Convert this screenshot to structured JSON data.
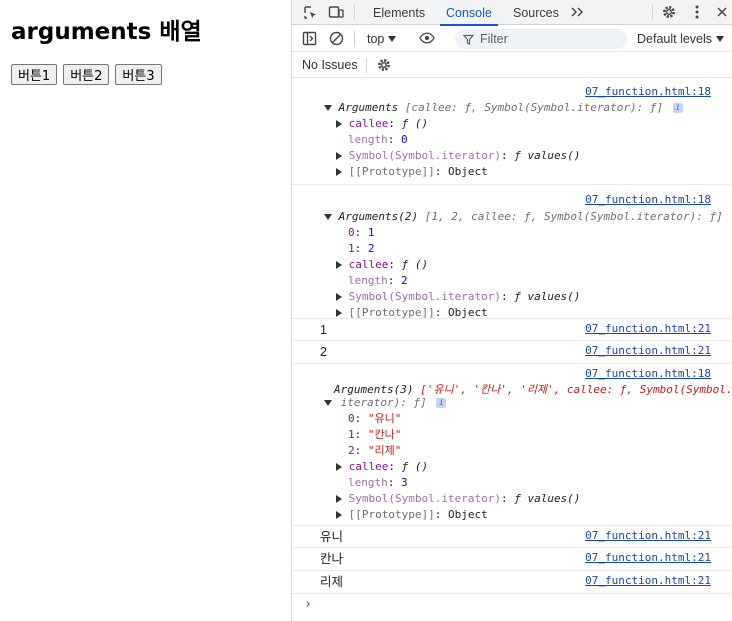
{
  "page": {
    "heading": "arguments 배열",
    "buttons": [
      "버튼1",
      "버튼2",
      "버튼3"
    ]
  },
  "devtools": {
    "tabs": [
      "Elements",
      "Console",
      "Sources"
    ],
    "active_tab": "Console",
    "context": "top",
    "filter_placeholder": "Filter",
    "levels": "Default levels",
    "issues": "No Issues",
    "prompt_glyph": "›"
  },
  "console": {
    "log1": {
      "source": "07_function.html:18",
      "summary_name": "Arguments",
      "summary_rest": "[callee: ƒ, Symbol(Symbol.iterator): ƒ]",
      "props": [
        {
          "key": "callee",
          "sep": ": ",
          "val": "ƒ ()"
        },
        {
          "key": "length",
          "sep": ": ",
          "val": "0"
        },
        {
          "key": "Symbol(Symbol.iterator)",
          "sep": ": ",
          "val": "ƒ values()"
        },
        {
          "key": "[[Prototype]]",
          "sep": ": ",
          "val": "Object"
        }
      ]
    },
    "log2": {
      "source": "07_function.html:18",
      "summary_name": "Arguments(2)",
      "summary_rest": "[1, 2, callee: ƒ, Symbol(Symbol.iterator): ƒ]",
      "props": [
        {
          "key": "0",
          "sep": ": ",
          "val": "1"
        },
        {
          "key": "1",
          "sep": ": ",
          "val": "2"
        },
        {
          "key": "callee",
          "sep": ": ",
          "val": "ƒ ()"
        },
        {
          "key": "length",
          "sep": ": ",
          "val": "2"
        },
        {
          "key": "Symbol(Symbol.iterator)",
          "sep": ": ",
          "val": "ƒ values()"
        },
        {
          "key": "[[Prototype]]",
          "sep": ": ",
          "val": "Object"
        }
      ]
    },
    "simple1": [
      {
        "text": "1",
        "source": "07_function.html:21"
      },
      {
        "text": "2",
        "source": "07_function.html:21"
      }
    ],
    "log3": {
      "source": "07_function.html:18",
      "summary_name": "Arguments(3)",
      "summary_rest_line1": "['유니', '칸나', '리제', callee: ƒ, Symbol(Symbol.",
      "summary_rest_line2": "iterator): ƒ]",
      "props": [
        {
          "key": "0",
          "sep": ": ",
          "val": "\"유니\""
        },
        {
          "key": "1",
          "sep": ": ",
          "val": "\"칸나\""
        },
        {
          "key": "2",
          "sep": ": ",
          "val": "\"리제\""
        },
        {
          "key": "callee",
          "sep": ": ",
          "val": "ƒ ()"
        },
        {
          "key": "length",
          "sep": ": ",
          "val": "3"
        },
        {
          "key": "Symbol(Symbol.iterator)",
          "sep": ": ",
          "val": "ƒ values()"
        },
        {
          "key": "[[Prototype]]",
          "sep": ": ",
          "val": "Object"
        }
      ]
    },
    "simple2": [
      {
        "text": "유니",
        "source": "07_function.html:21"
      },
      {
        "text": "칸나",
        "source": "07_function.html:21"
      },
      {
        "text": "리제",
        "source": "07_function.html:21"
      }
    ]
  }
}
